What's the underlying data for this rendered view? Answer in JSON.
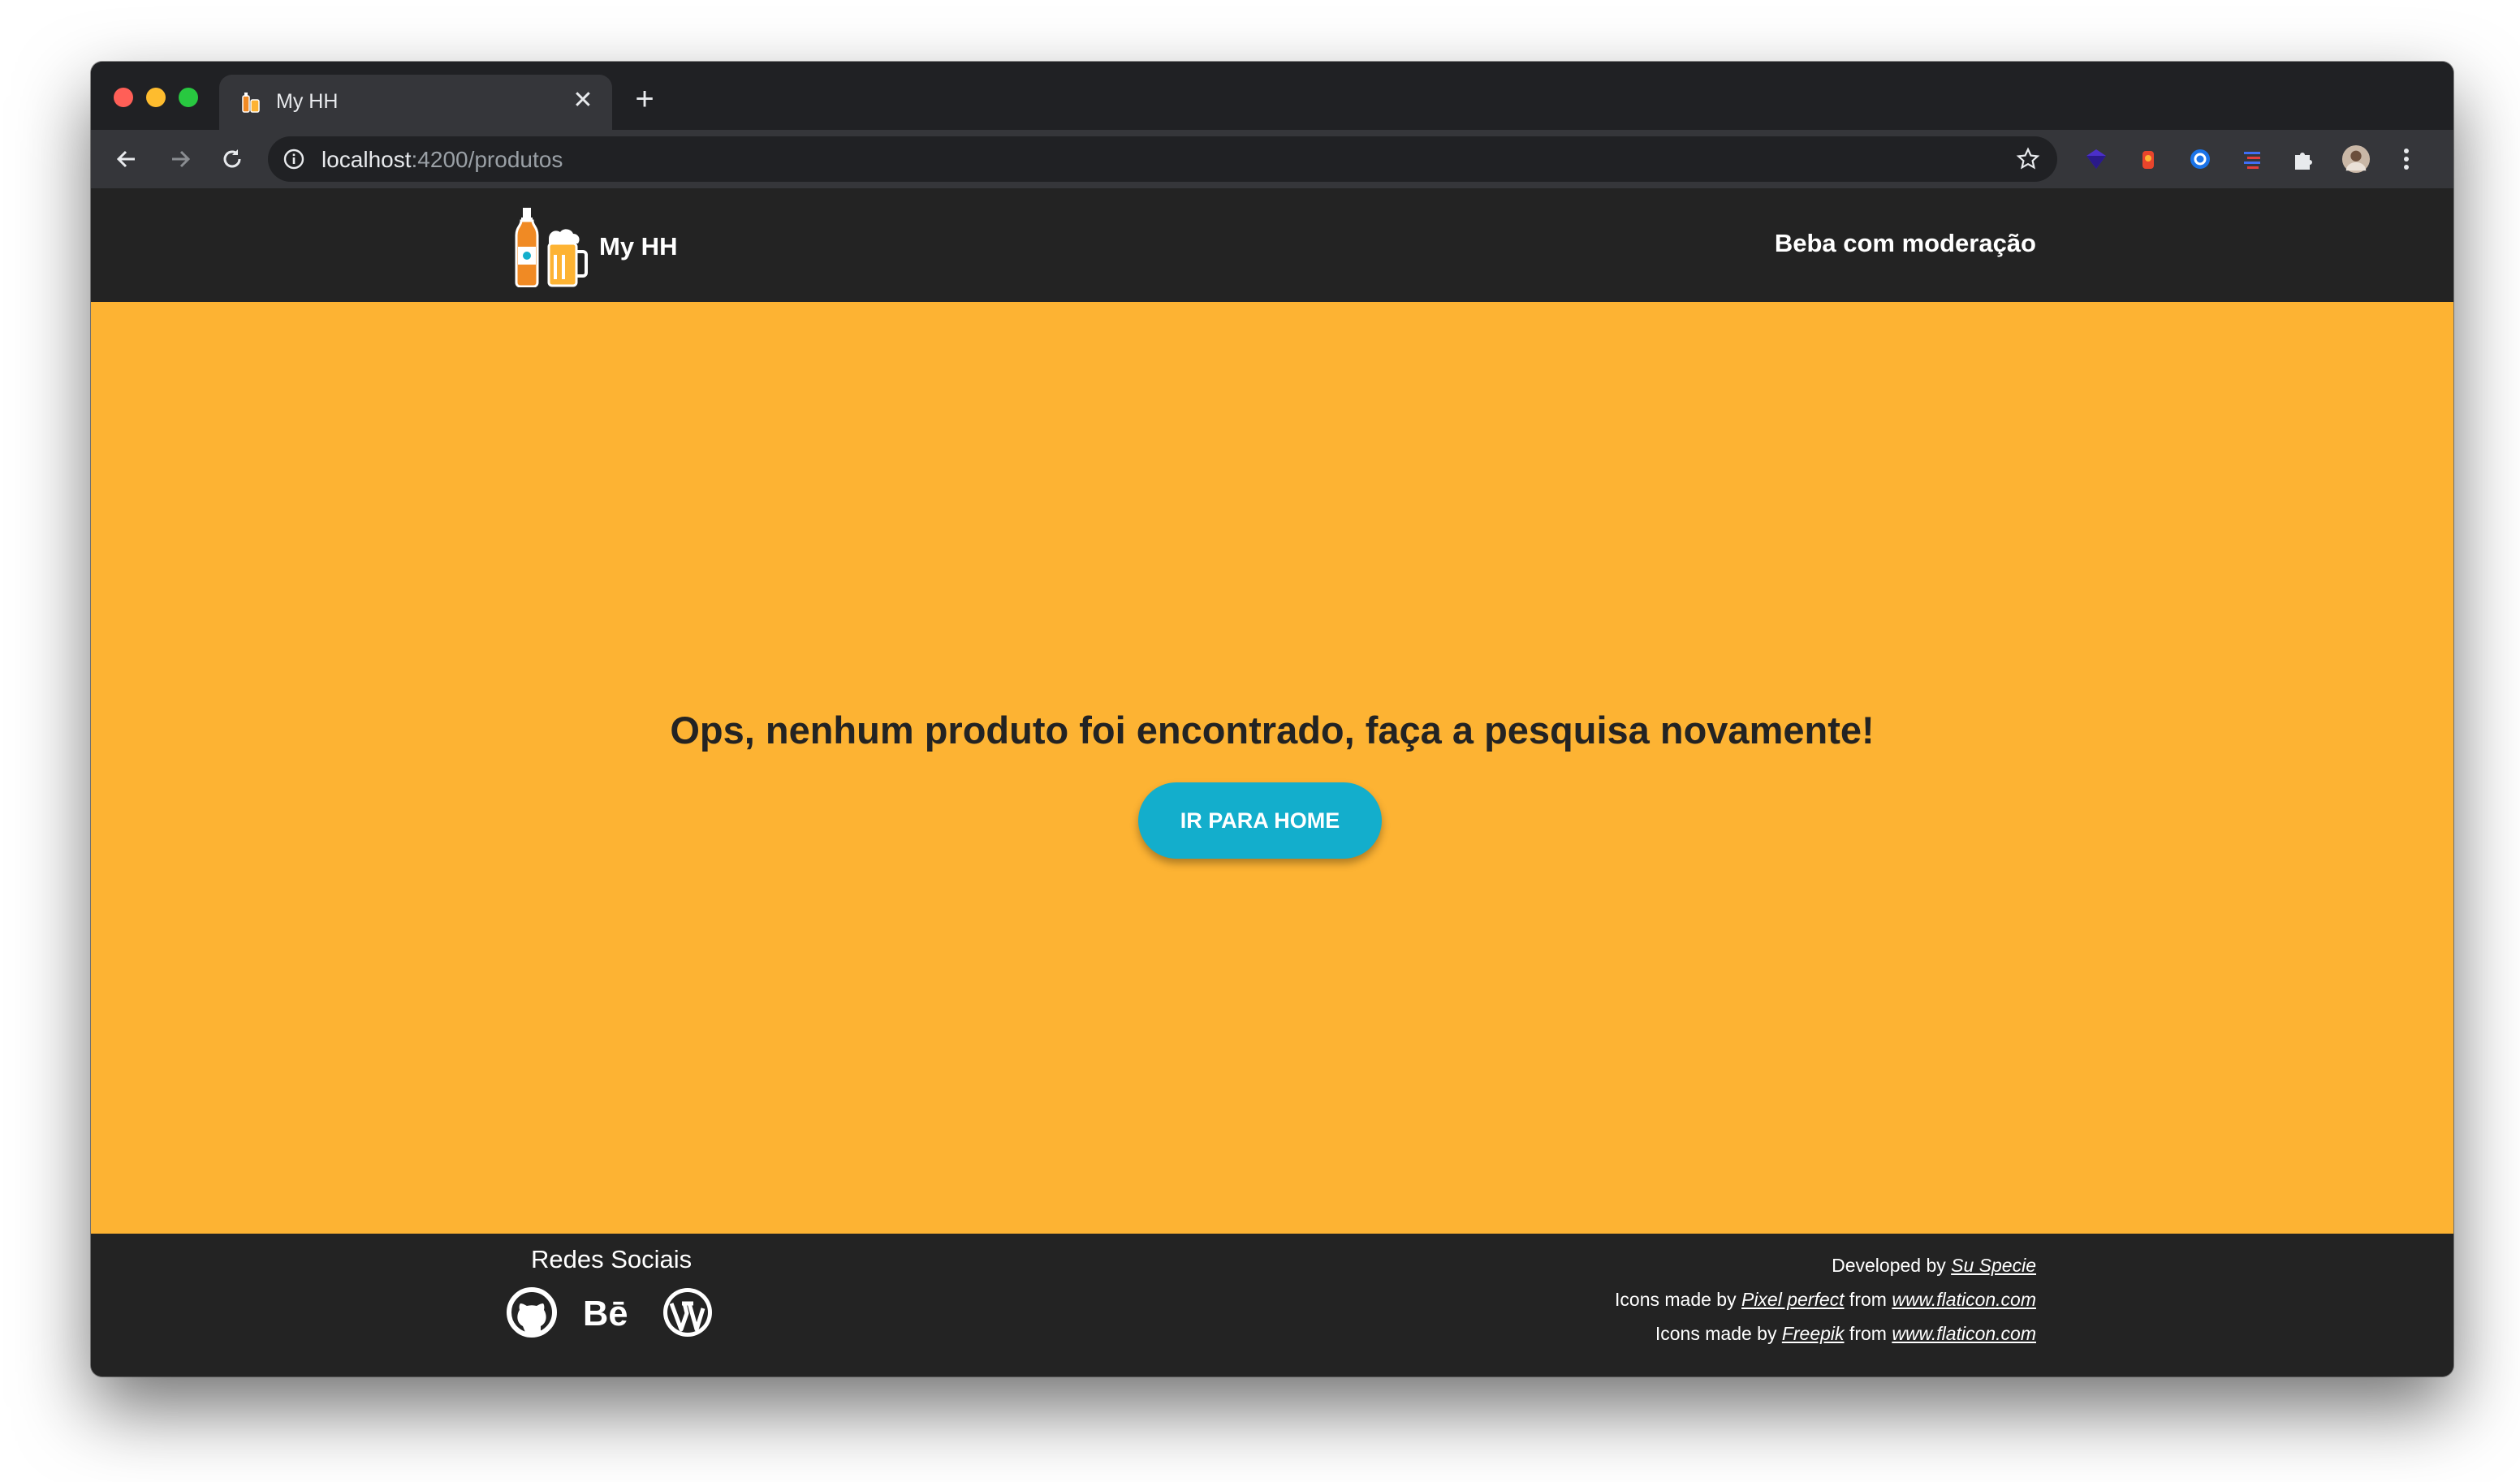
{
  "browser": {
    "tab_title": "My HH",
    "tab_close": "✕",
    "new_tab": "+",
    "url_host": "localhost",
    "url_path": ":4200/produtos",
    "icons": [
      "back-arrow-icon",
      "forward-arrow-icon",
      "reload-icon",
      "info-icon",
      "star-icon",
      "extensions-puzzle-icon",
      "profile-avatar-icon",
      "menu-kebab-icon"
    ]
  },
  "header": {
    "brand_name": "My HH",
    "tagline": "Beba com moderação"
  },
  "main": {
    "message": "Ops, nenhum produto foi encontrado, faça a pesquisa novamente!",
    "home_button": "IR PARA HOME"
  },
  "footer": {
    "social_title": "Redes Sociais",
    "social_icons": [
      "github-icon",
      "behance-icon",
      "wordpress-icon"
    ],
    "credit1_prefix": "Developed by ",
    "credit1_link": "Su Specie",
    "credit2_prefix": "Icons made by ",
    "credit2_author": "Pixel perfect",
    "credit2_from": " from ",
    "credit2_site": "www.flaticon.com",
    "credit3_prefix": "Icons made by ",
    "credit3_author": "Freepik",
    "credit3_from": " from ",
    "credit3_site": "www.flaticon.com"
  },
  "colors": {
    "main_bg": "#fdb333",
    "header_bg": "#232323",
    "button_bg": "#13aecc",
    "browser_chrome": "#202124"
  }
}
